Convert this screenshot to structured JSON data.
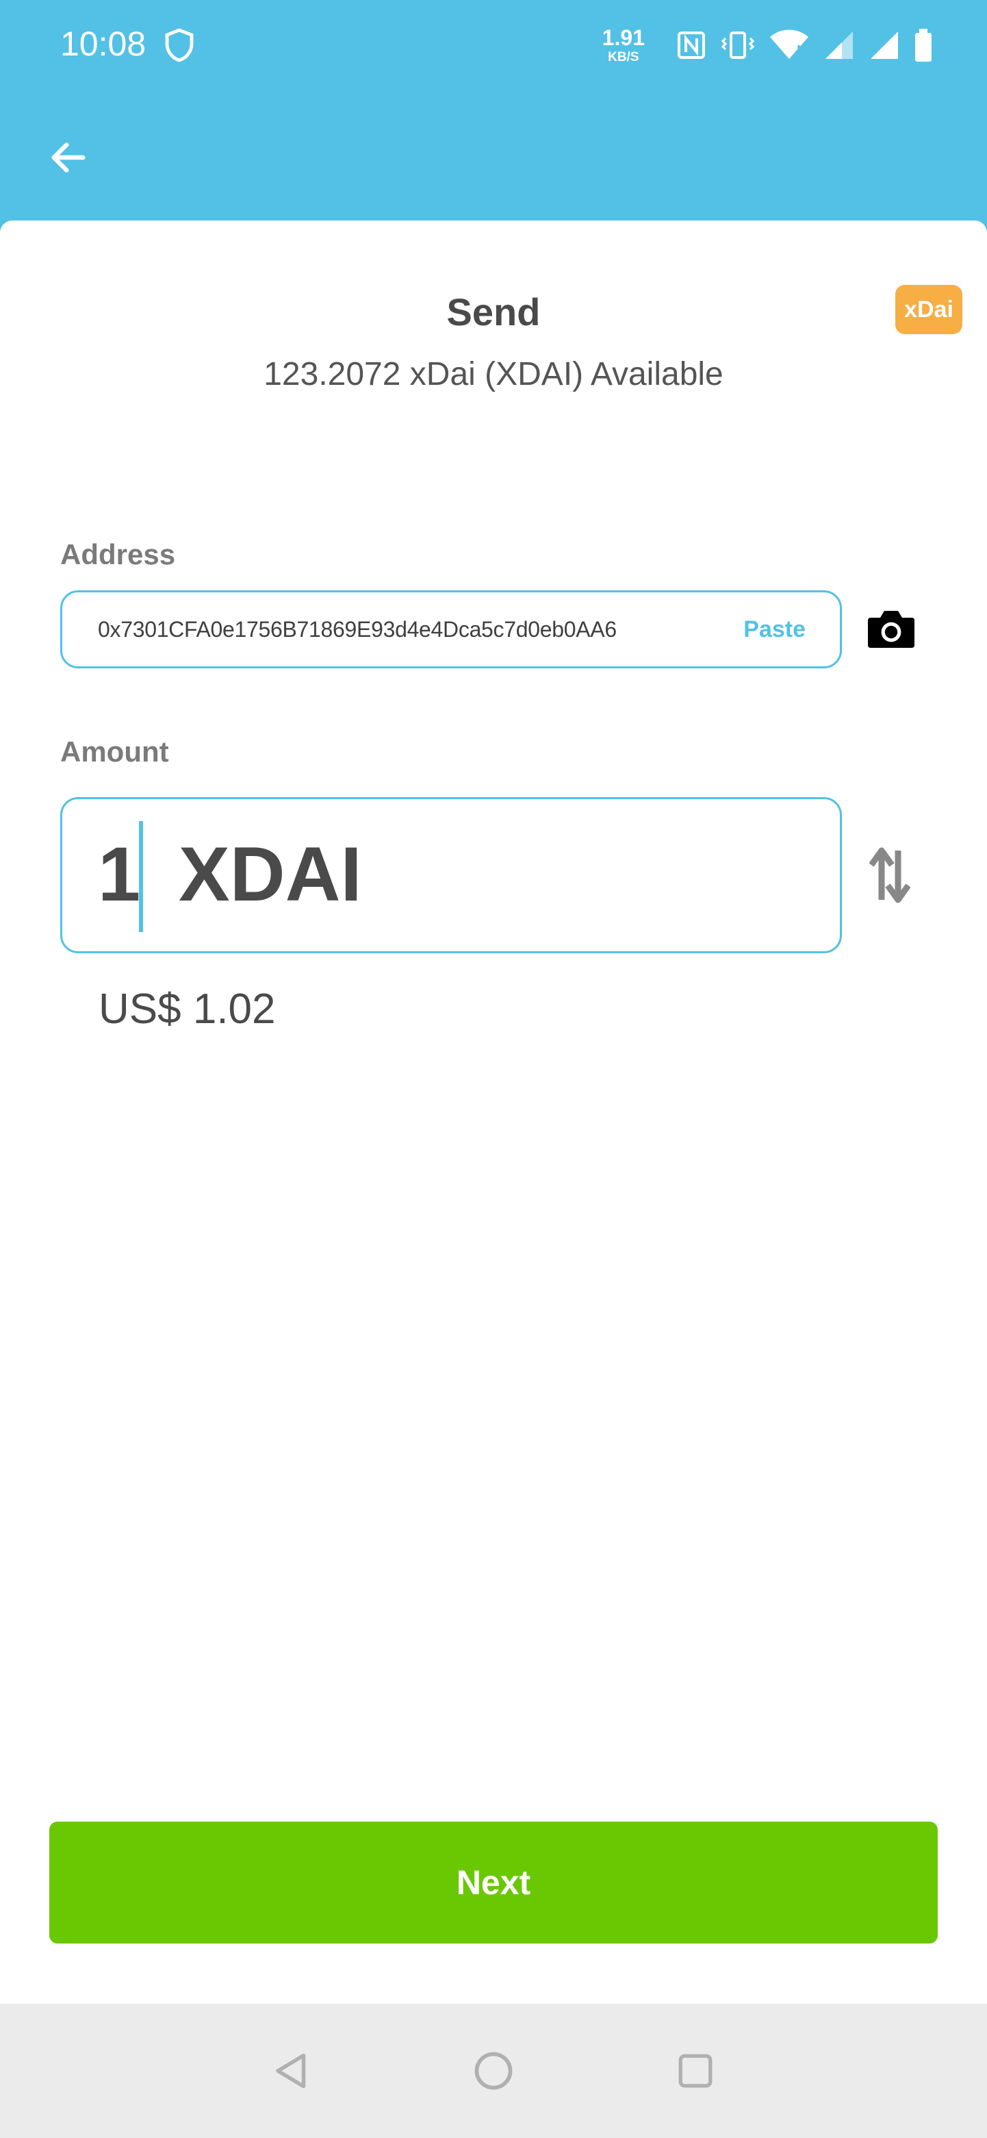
{
  "status_bar": {
    "time": "10:08",
    "network_speed": "1.91",
    "network_speed_unit": "KB/S",
    "icons": [
      "shield-icon",
      "nfc-icon",
      "vibrate-icon",
      "wifi-icon",
      "signal-icon",
      "signal-icon",
      "battery-icon"
    ]
  },
  "header": {
    "back_icon": "arrow-left-icon"
  },
  "send": {
    "title": "Send",
    "available": "123.2072 xDai (XDAI)  Available",
    "token_badge": "xDai"
  },
  "address": {
    "label": "Address",
    "value": "0x7301CFA0e1756B71869E93d4e4Dca5c7d0eb0AA6",
    "paste_label": "Paste",
    "camera_icon": "camera-icon"
  },
  "amount": {
    "label": "Amount",
    "value": "1",
    "unit": "XDAI",
    "fiat": "US$ 1.02",
    "swap_icon": "swap-vertical-icon"
  },
  "actions": {
    "next_label": "Next"
  },
  "nav_bar": {
    "icons": [
      "triangle-back-icon",
      "circle-home-icon",
      "square-recents-icon"
    ]
  },
  "colors": {
    "primary": "#52c1e5",
    "next_button": "#6ac802",
    "badge": "#f6ae45"
  }
}
